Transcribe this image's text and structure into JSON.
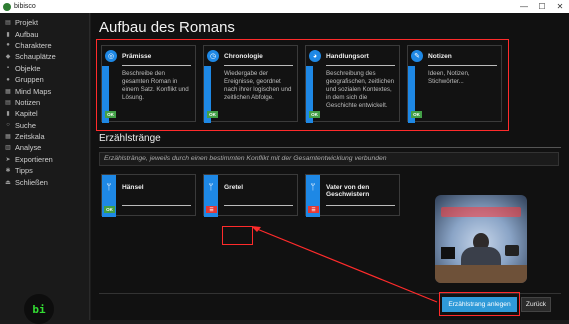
{
  "window": {
    "title": "bibisco",
    "controls": {
      "minimize": "—",
      "maximize": "☐",
      "close": "✕"
    }
  },
  "sidebar": {
    "items": [
      {
        "label": "Projekt",
        "icon": "file-icon",
        "glyph": "▤"
      },
      {
        "label": "Aufbau",
        "icon": "bookmark-icon",
        "glyph": "▮"
      },
      {
        "label": "Charaktere",
        "icon": "users-icon",
        "glyph": "●"
      },
      {
        "label": "Schauplätze",
        "icon": "map-marker-icon",
        "glyph": "◆"
      },
      {
        "label": "Objekte",
        "icon": "cube-icon",
        "glyph": "▪"
      },
      {
        "label": "Gruppen",
        "icon": "group-icon",
        "glyph": "●"
      },
      {
        "label": "Mind Maps",
        "icon": "sitemap-icon",
        "glyph": "▦"
      },
      {
        "label": "Notizen",
        "icon": "notes-icon",
        "glyph": "▤"
      },
      {
        "label": "Kapitel",
        "icon": "book-icon",
        "glyph": "▮"
      },
      {
        "label": "Suche",
        "icon": "search-icon",
        "glyph": "○"
      },
      {
        "label": "Zeitskala",
        "icon": "calendar-icon",
        "glyph": "▦"
      },
      {
        "label": "Analyse",
        "icon": "chart-icon",
        "glyph": "▥"
      },
      {
        "label": "Exportieren",
        "icon": "export-icon",
        "glyph": "➤"
      },
      {
        "label": "Tipps",
        "icon": "lightbulb-icon",
        "glyph": "✱"
      },
      {
        "label": "Schließen",
        "icon": "logout-icon",
        "glyph": "⏏"
      }
    ],
    "logo_text": "bi"
  },
  "main": {
    "title": "Aufbau des Romans",
    "structure_cards": [
      {
        "title": "Prämisse",
        "icon": "target-icon",
        "glyph": "◎",
        "description": "Beschreibe den gesamten Roman in einem Satz. Konflikt und Lösung.",
        "badge": "OK",
        "status": "ok"
      },
      {
        "title": "Chronologie",
        "icon": "clock-icon",
        "glyph": "◷",
        "description": "Wiedergabe der Ereignisse, geordnet nach ihrer logischen und zeitlichen Abfolge.",
        "badge": "OK",
        "status": "ok"
      },
      {
        "title": "Handlungsort",
        "icon": "globe-icon",
        "glyph": "◕",
        "description": "Beschreibung des geografischen, zeitlichen und sozialen Kontextes, in dem sich die Geschichte entwickelt.",
        "badge": "OK",
        "status": "ok"
      },
      {
        "title": "Notizen",
        "icon": "pin-icon",
        "glyph": "✎",
        "description": "Ideen, Notizen, Stichwörter...",
        "badge": "OK",
        "status": "ok"
      }
    ],
    "strands_section": {
      "title": "Erzählstränge",
      "description": "Erzählstränge, jeweils durch einen bestimmten Konflikt mit der Gesamtentwicklung verbunden",
      "cards": [
        {
          "title": "Hänsel",
          "icon": "branch-icon",
          "glyph": "ᛘ",
          "badge": "OK",
          "status": "ok"
        },
        {
          "title": "Gretel",
          "icon": "branch-icon",
          "glyph": "ᛘ",
          "badge": "☰",
          "status": "no"
        },
        {
          "title": "Vater von den Geschwistern",
          "icon": "branch-icon",
          "glyph": "ᛘ",
          "badge": "☰",
          "status": "no"
        }
      ]
    },
    "buttons": {
      "create_strand": "Erzählstrang anlegen",
      "back": "Zurück"
    },
    "photo_text": "MisterTutorial"
  },
  "colors": {
    "accent": "#1e88e5",
    "ok": "#43a047",
    "todo": "#e53935",
    "highlight": "#ff2b2b",
    "primary_button": "#2f9ad8"
  }
}
